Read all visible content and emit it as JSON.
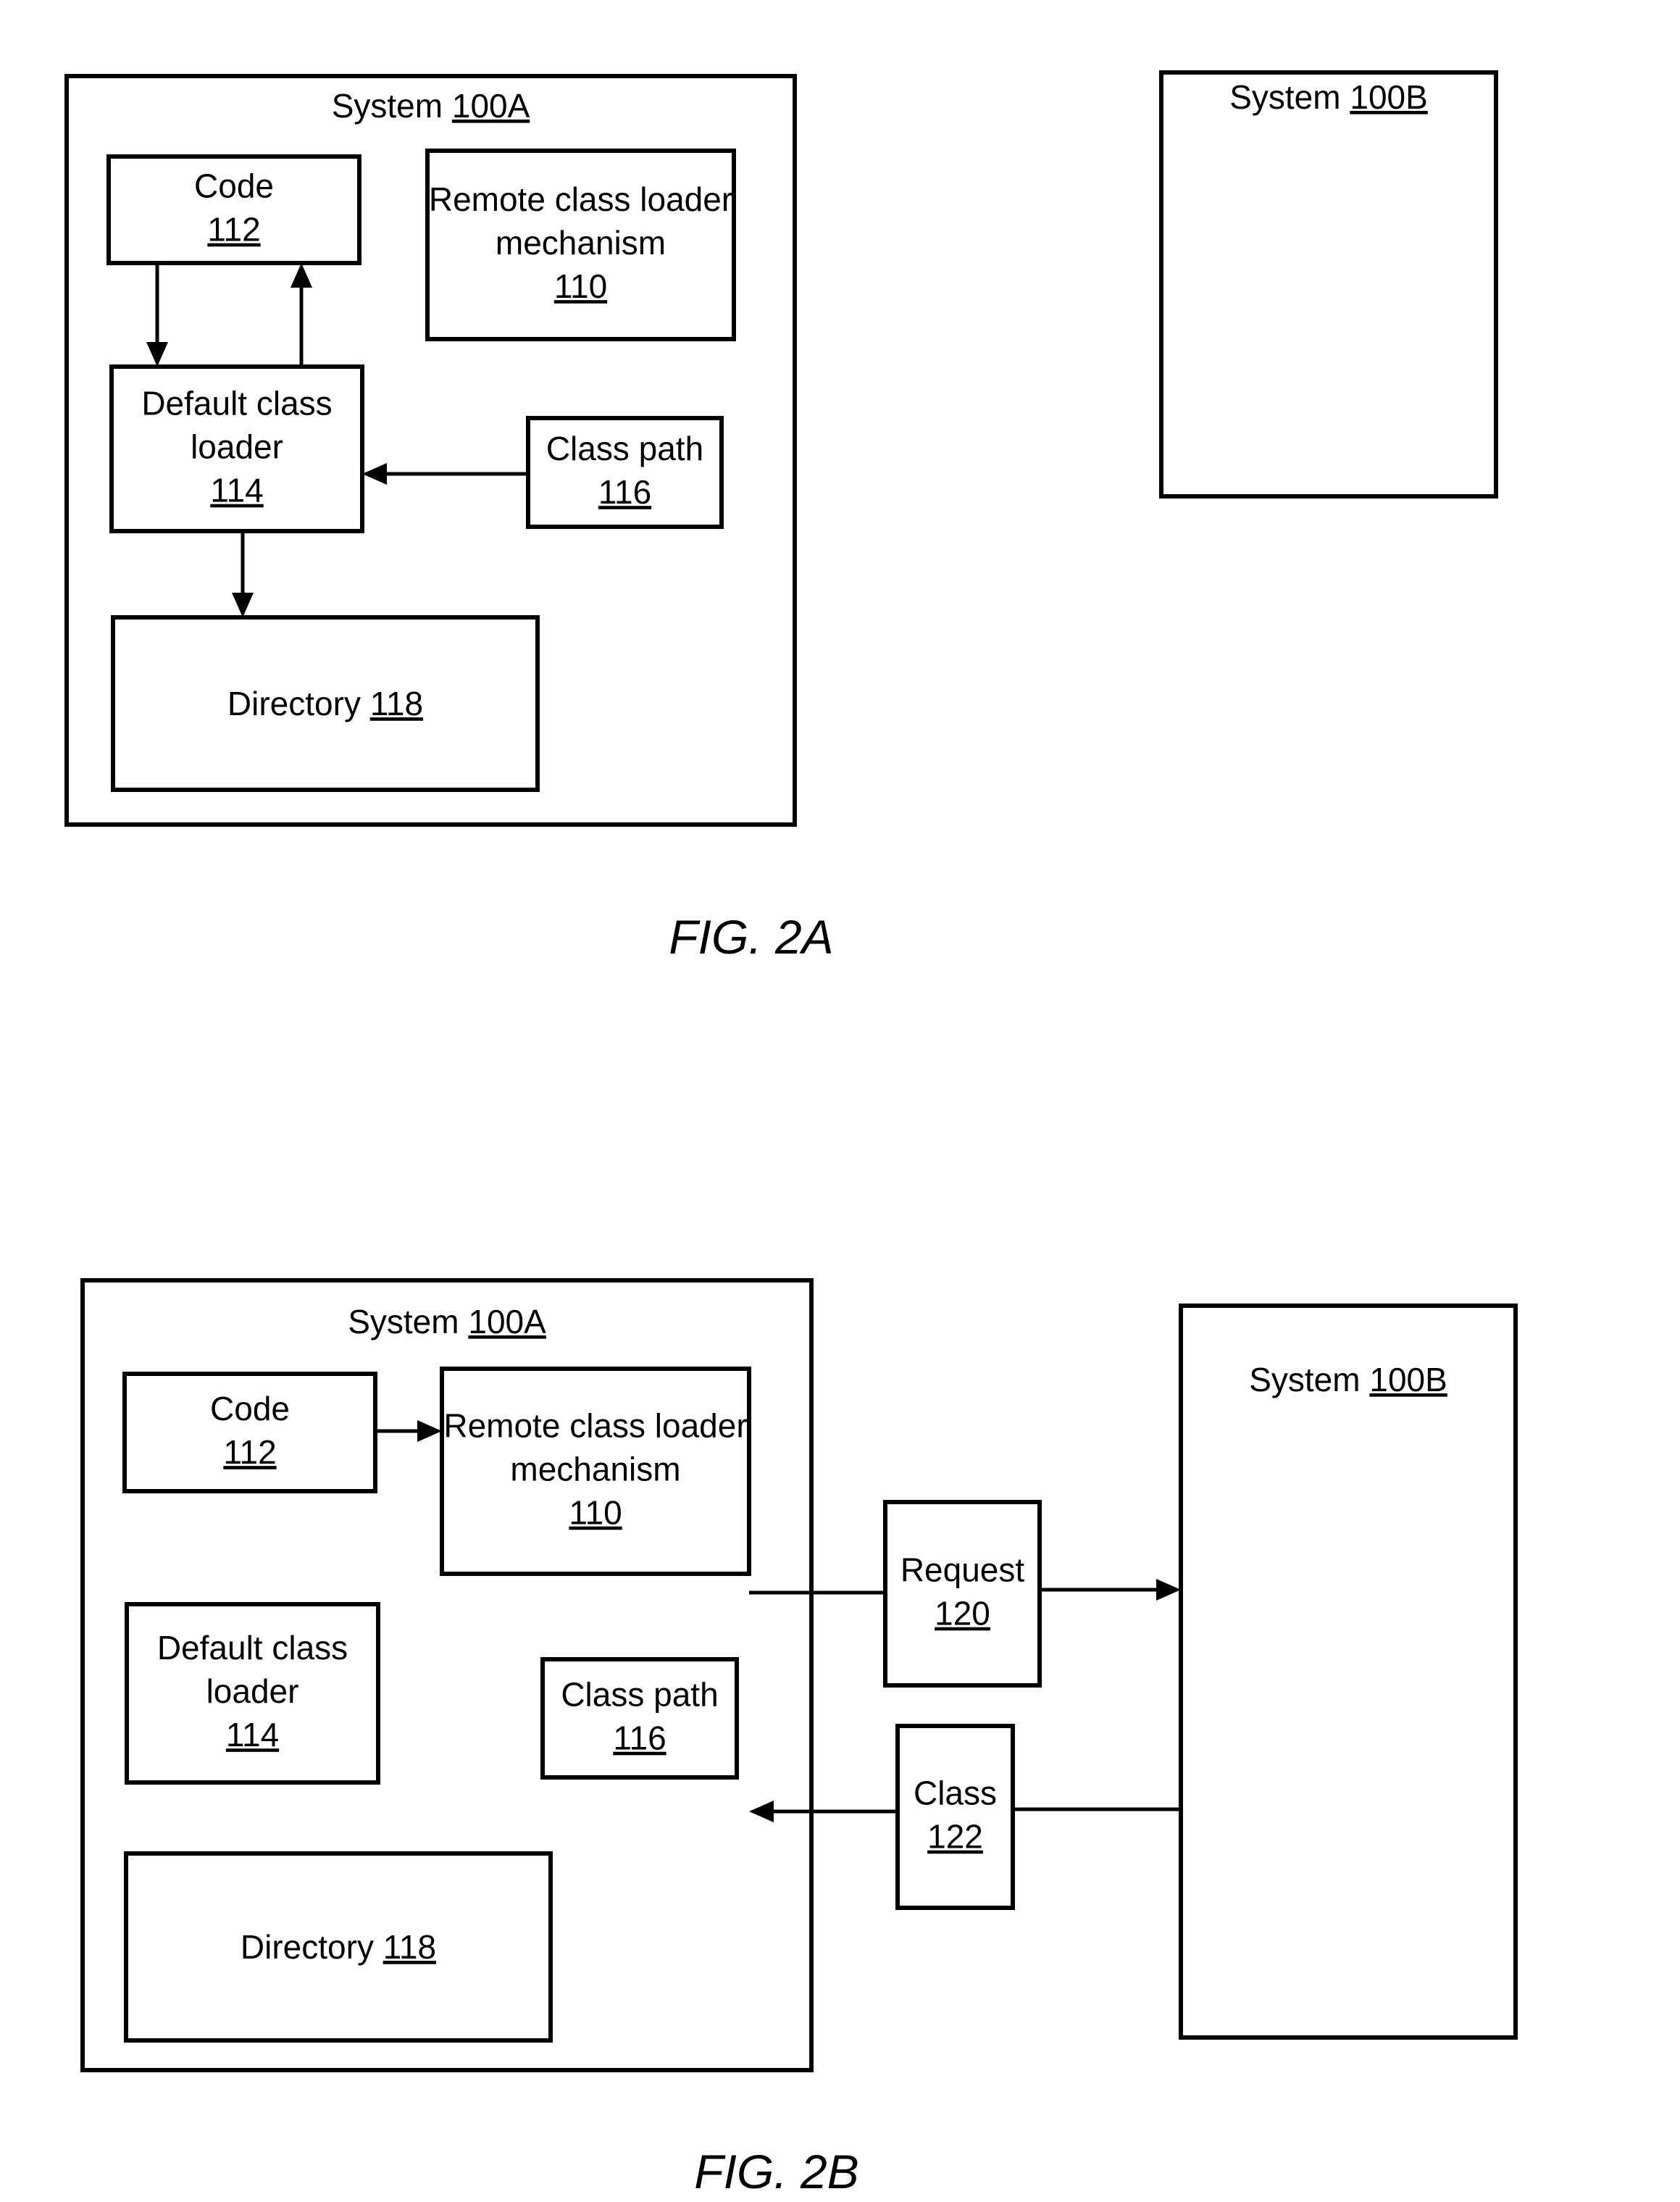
{
  "figures": [
    {
      "id": "fig2a",
      "caption": "FIG. 2A",
      "system_a": {
        "title": "System",
        "ref": "100A"
      },
      "system_b": {
        "title": "System",
        "ref": "100B"
      },
      "blocks": {
        "code": {
          "lines": [
            "Code"
          ],
          "ref": "112"
        },
        "remote": {
          "lines": [
            "Remote class loader",
            "mechanism"
          ],
          "ref": "110"
        },
        "default_loader": {
          "lines": [
            "Default class",
            "loader"
          ],
          "ref": "114"
        },
        "class_path": {
          "lines": [
            "Class path"
          ],
          "ref": "116"
        },
        "directory": {
          "lines": [
            "Directory"
          ],
          "ref": "118"
        }
      },
      "arrows": [
        {
          "from": "code",
          "to": "default_loader"
        },
        {
          "from": "default_loader",
          "to": "code"
        },
        {
          "from": "class_path",
          "to": "default_loader"
        },
        {
          "from": "default_loader",
          "to": "directory"
        }
      ]
    },
    {
      "id": "fig2b",
      "caption": "FIG. 2B",
      "system_a": {
        "title": "System",
        "ref": "100A"
      },
      "system_b": {
        "title": "System",
        "ref": "100B"
      },
      "blocks": {
        "code": {
          "lines": [
            "Code"
          ],
          "ref": "112"
        },
        "remote": {
          "lines": [
            "Remote class loader",
            "mechanism"
          ],
          "ref": "110"
        },
        "default_loader": {
          "lines": [
            "Default class",
            "loader"
          ],
          "ref": "114"
        },
        "class_path": {
          "lines": [
            "Class path"
          ],
          "ref": "116"
        },
        "directory": {
          "lines": [
            "Directory"
          ],
          "ref": "118"
        },
        "request": {
          "lines": [
            "Request"
          ],
          "ref": "120"
        },
        "class": {
          "lines": [
            "Class"
          ],
          "ref": "122"
        }
      },
      "arrows": [
        {
          "from": "code",
          "to": "remote"
        },
        {
          "from": "remote",
          "to": "system_b",
          "via": "request"
        },
        {
          "from": "system_b",
          "to": "remote",
          "via": "class"
        }
      ]
    }
  ]
}
